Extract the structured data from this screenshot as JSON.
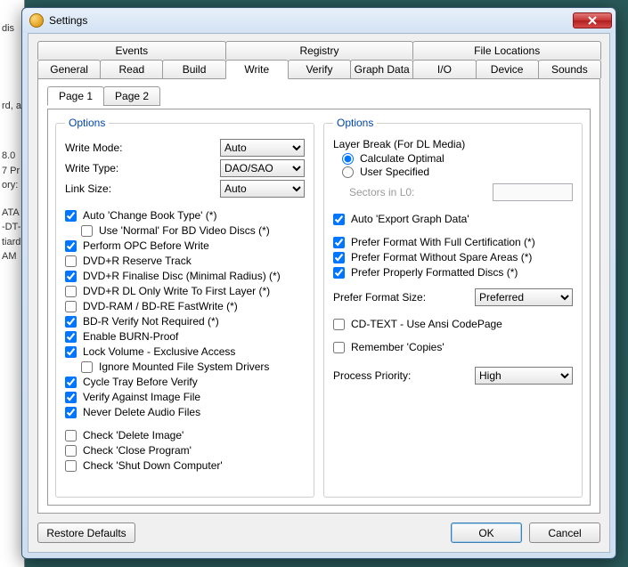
{
  "window": {
    "title": "Settings"
  },
  "bg_fragments": [
    "dis",
    "rd, a",
    "8.0",
    "7 Pr",
    "ory:",
    "ATA",
    "-DT-",
    "tiard",
    "AM"
  ],
  "tabs_top": [
    "Events",
    "Registry",
    "File Locations"
  ],
  "tabs_bottom": [
    "General",
    "Read",
    "Build",
    "Write",
    "Verify",
    "Graph Data",
    "I/O",
    "Device",
    "Sounds"
  ],
  "active_tab": "Write",
  "page_tabs": [
    "Page 1",
    "Page 2"
  ],
  "active_page": "Page 1",
  "left": {
    "legend": "Options",
    "write_mode_label": "Write Mode:",
    "write_mode_value": "Auto",
    "write_type_label": "Write Type:",
    "write_type_value": "DAO/SAO",
    "link_size_label": "Link Size:",
    "link_size_value": "Auto",
    "checks": {
      "auto_change_book_type": {
        "label": "Auto 'Change Book Type' (*)",
        "checked": true
      },
      "use_normal_bd": {
        "label": "Use 'Normal' For BD Video Discs (*)",
        "checked": false
      },
      "perform_opc": {
        "label": "Perform OPC Before Write",
        "checked": true
      },
      "dvdr_reserve": {
        "label": "DVD+R Reserve Track",
        "checked": false
      },
      "dvdr_finalise": {
        "label": "DVD+R Finalise Disc (Minimal Radius) (*)",
        "checked": true
      },
      "dvdr_dl_first": {
        "label": "DVD+R DL Only Write To First Layer (*)",
        "checked": false
      },
      "dvdram_fastwrite": {
        "label": "DVD-RAM / BD-RE FastWrite (*)",
        "checked": false
      },
      "bdr_verify_not_req": {
        "label": "BD-R Verify Not Required (*)",
        "checked": true
      },
      "enable_burnproof": {
        "label": "Enable BURN-Proof",
        "checked": true
      },
      "lock_volume": {
        "label": "Lock Volume - Exclusive Access",
        "checked": true
      },
      "ignore_mounted": {
        "label": "Ignore Mounted File System Drivers",
        "checked": false
      },
      "cycle_tray": {
        "label": "Cycle Tray Before Verify",
        "checked": true
      },
      "verify_against_image": {
        "label": "Verify Against Image File",
        "checked": true
      },
      "never_delete_audio": {
        "label": "Never Delete Audio Files",
        "checked": true
      },
      "check_delete_image": {
        "label": "Check 'Delete Image'",
        "checked": false
      },
      "check_close_program": {
        "label": "Check 'Close Program'",
        "checked": false
      },
      "check_shutdown": {
        "label": "Check 'Shut Down Computer'",
        "checked": false
      }
    }
  },
  "right": {
    "legend": "Options",
    "layer_break_title": "Layer Break (For DL Media)",
    "radio_calc": "Calculate Optimal",
    "radio_user": "User Specified",
    "sectors_label": "Sectors in L0:",
    "auto_export_graph": {
      "label": "Auto 'Export Graph Data'",
      "checked": true
    },
    "prefer_full_cert": {
      "label": "Prefer Format With Full Certification (*)",
      "checked": true
    },
    "prefer_no_spare": {
      "label": "Prefer Format Without Spare Areas (*)",
      "checked": true
    },
    "prefer_properly_fmt": {
      "label": "Prefer Properly Formatted Discs (*)",
      "checked": true
    },
    "prefer_format_size_label": "Prefer Format Size:",
    "prefer_format_size_value": "Preferred",
    "cdtext_ansi": {
      "label": "CD-TEXT - Use Ansi CodePage",
      "checked": false
    },
    "remember_copies": {
      "label": "Remember 'Copies'",
      "checked": false
    },
    "process_priority_label": "Process Priority:",
    "process_priority_value": "High"
  },
  "footer": {
    "restore": "Restore Defaults",
    "ok": "OK",
    "cancel": "Cancel"
  }
}
